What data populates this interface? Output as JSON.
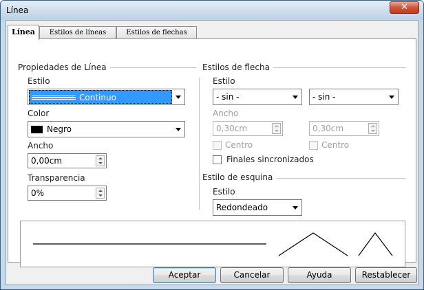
{
  "window": {
    "title": "Línea",
    "close_glyph": "✕"
  },
  "tabs": [
    {
      "label": "Línea"
    },
    {
      "label": "Estilos de líneas"
    },
    {
      "label": "Estilos de flechas"
    }
  ],
  "line_props": {
    "title": "Propiedades de Línea",
    "style_label": "Estilo",
    "style_value": "Continuo",
    "color_label": "Color",
    "color_value": "Negro",
    "color_hex": "#000000",
    "width_label": "Ancho",
    "width_value": "0,00cm",
    "transparency_label": "Transparencia",
    "transparency_value": "0%"
  },
  "arrow_styles": {
    "title": "Estilos de flecha",
    "style_label": "Estilo",
    "start_style": "- sin -",
    "end_style": "- sin -",
    "width_label": "Ancho",
    "start_width": "0,30cm",
    "end_width": "0,30cm",
    "center_label": "Centro",
    "center_label_2": "Centro",
    "sync_label": "Finales sincronizados"
  },
  "corner_styles": {
    "title": "Estilo de esquina",
    "style_label": "Estilo",
    "style_value": "Redondeado"
  },
  "buttons": {
    "ok": "Aceptar",
    "cancel": "Cancelar",
    "help": "Ayuda",
    "reset": "Restablecer"
  },
  "colors": {
    "selection": "#3399ff",
    "title_bar": "#c6d8ea",
    "close": "#c4391e"
  }
}
